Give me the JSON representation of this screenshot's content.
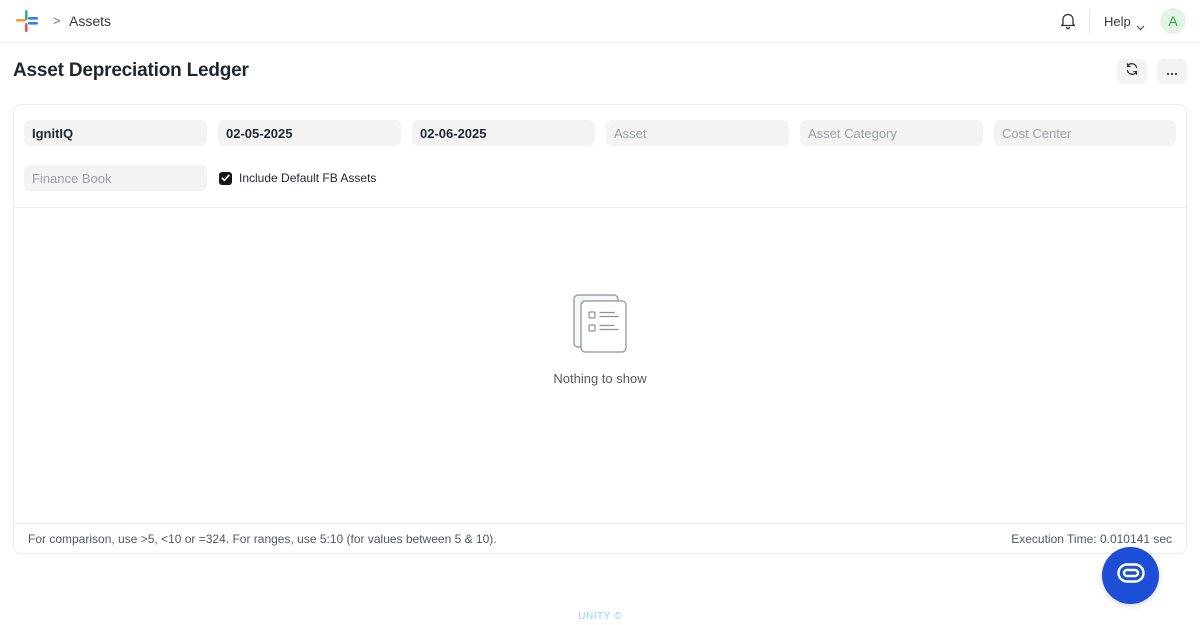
{
  "breadcrumb": {
    "separator": ">",
    "current": "Assets"
  },
  "navbar": {
    "help_label": "Help",
    "avatar_initial": "A"
  },
  "page": {
    "title": "Asset Depreciation Ledger"
  },
  "filters": {
    "company": {
      "value": "IgnitIQ",
      "placeholder": ""
    },
    "from_date": {
      "value": "02-05-2025",
      "placeholder": ""
    },
    "to_date": {
      "value": "02-06-2025",
      "placeholder": ""
    },
    "asset": {
      "value": "",
      "placeholder": "Asset"
    },
    "asset_category": {
      "value": "",
      "placeholder": "Asset Category"
    },
    "cost_center": {
      "value": "",
      "placeholder": "Cost Center"
    },
    "finance_book": {
      "value": "",
      "placeholder": "Finance Book"
    },
    "include_default_fb": {
      "label": "Include Default FB Assets",
      "checked": true
    }
  },
  "report": {
    "empty_message": "Nothing to show",
    "footer_hint": "For comparison, use >5, <10 or =324. For ranges, use 5:10 (for values between 5 & 10).",
    "execution_time": "Execution Time: 0.010141 sec"
  },
  "footer": {
    "brand": "UNITY ©"
  },
  "colors": {
    "accent": "#1d4ed8",
    "checkbox": "#171717",
    "avatar_bg": "#e3f4e6",
    "avatar_fg": "#30a14e"
  },
  "icons": [
    "app-logo-icon",
    "bell-icon",
    "chevron-down-icon",
    "refresh-icon",
    "ellipsis-icon",
    "empty-list-icon",
    "chat-icon"
  ]
}
